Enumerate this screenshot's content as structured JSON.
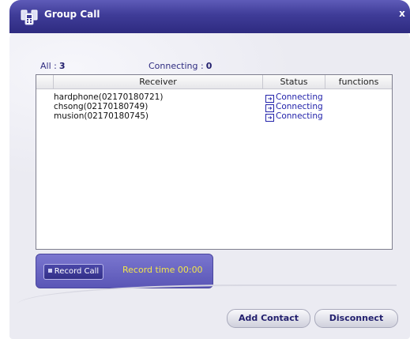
{
  "window": {
    "title": "Group Call",
    "close_label": "x"
  },
  "counters": {
    "all_label": "All :",
    "all_value": "3",
    "connecting_label": "Connecting :",
    "connecting_value": "0"
  },
  "table": {
    "columns": [
      "",
      "Receiver",
      "Status",
      "functions"
    ],
    "rows": [
      {
        "receiver": "hardphone(02170180721)",
        "status": "Connecting"
      },
      {
        "receiver": "chsong(02170180749)",
        "status": "Connecting"
      },
      {
        "receiver": "musion(02170180745)",
        "status": "Connecting"
      }
    ]
  },
  "record": {
    "button_label": "Record Call",
    "time_label": "Record time",
    "time_value": "00:00"
  },
  "buttons": {
    "add_contact": "Add Contact",
    "disconnect": "Disconnect"
  },
  "icons": {
    "title_icon": "group-phone-icon",
    "status_icon": "arrow-right-icon"
  },
  "colors": {
    "title_bar": "#3f3c98",
    "accent_text": "#2e2b80",
    "record_time": "#f2e64a",
    "status_text": "#2222aa"
  }
}
